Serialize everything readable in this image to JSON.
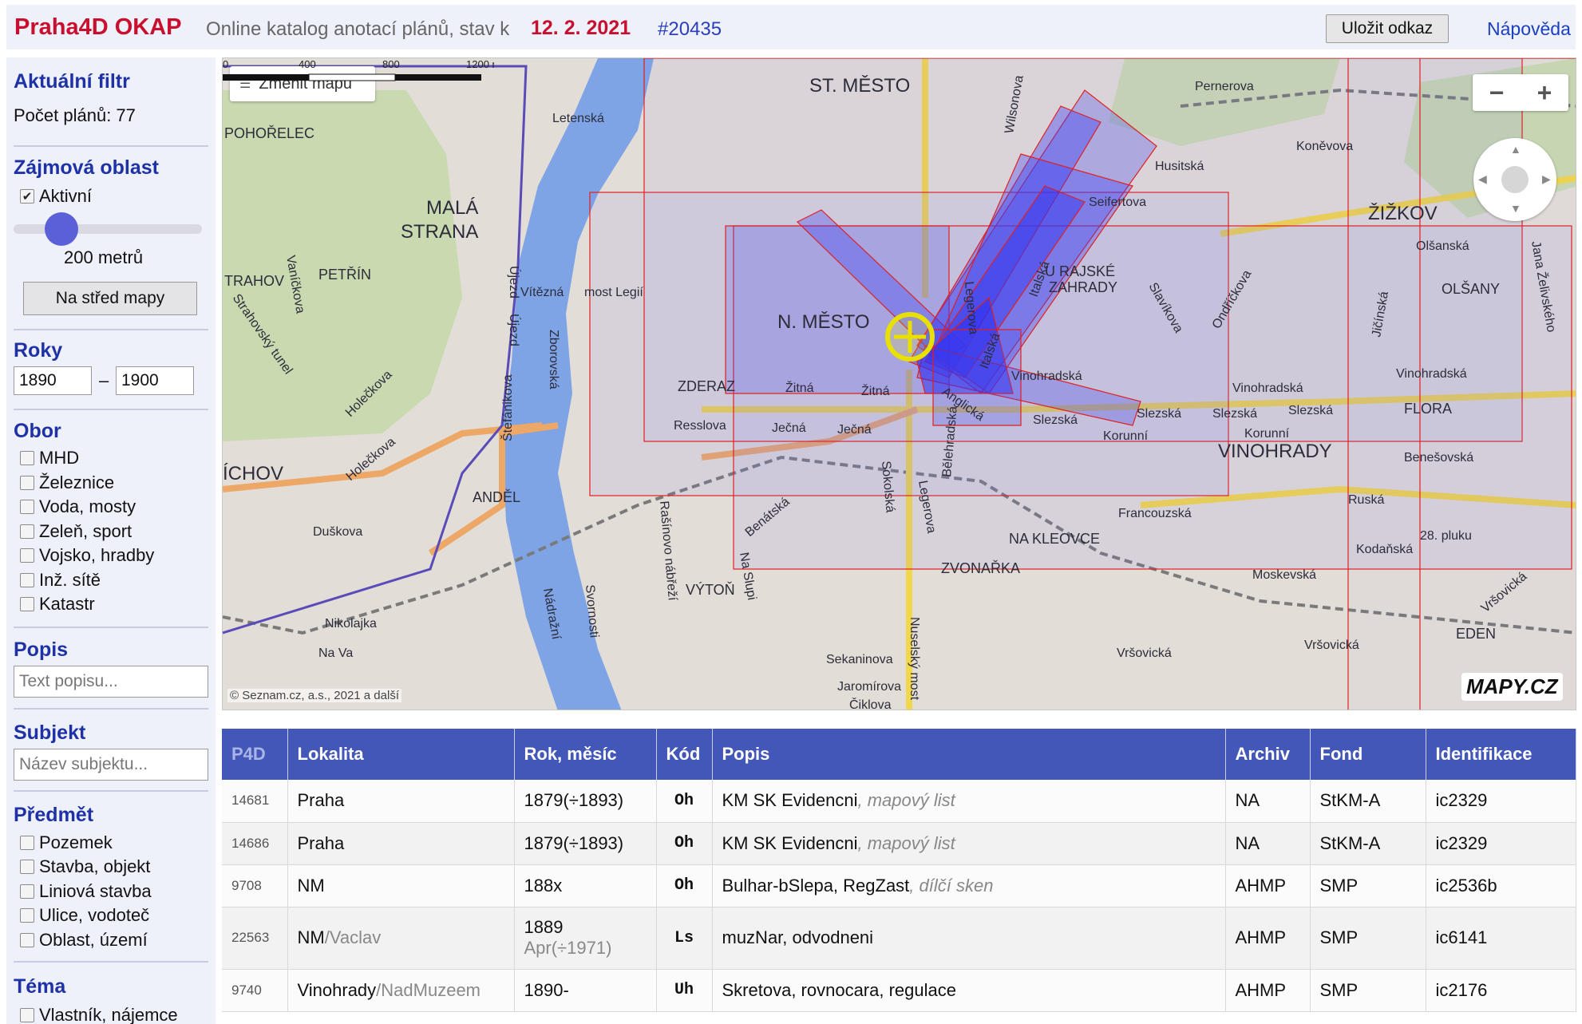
{
  "header": {
    "title": "Praha4D OKAP",
    "subtitle": "Online katalog anotací plánů, stav k",
    "date": "12. 2. 2021",
    "id": "#20435",
    "save_link": "Uložit odkaz",
    "help": "Nápověda"
  },
  "sidebar": {
    "filter": {
      "heading": "Aktuální filtr",
      "count_text": "Počet plánů: 77"
    },
    "area": {
      "heading": "Zájmová oblast",
      "active_label": "Aktivní",
      "active_checked": true,
      "radius": "200 metrů",
      "center_button": "Na střed mapy"
    },
    "years": {
      "heading": "Roky",
      "from": "1890",
      "dash": "–",
      "to": "1900"
    },
    "field": {
      "heading": "Obor",
      "items": [
        "MHD",
        "Železnice",
        "Voda, mosty",
        "Zeleň, sport",
        "Vojsko, hradby",
        "Inž. sítě",
        "Katastr"
      ]
    },
    "description": {
      "heading": "Popis",
      "placeholder": "Text popisu..."
    },
    "subject": {
      "heading": "Subjekt",
      "placeholder": "Název subjektu..."
    },
    "object": {
      "heading": "Předmět",
      "items": [
        "Pozemek",
        "Stavba, objekt",
        "Liniová stavba",
        "Ulice, vodoteč",
        "Oblast, území"
      ]
    },
    "theme": {
      "heading": "Téma",
      "items": [
        "Vlastník, nájemce"
      ]
    }
  },
  "map": {
    "change_map": "Změnit mapu",
    "zoom_out": "−",
    "zoom_in": "+",
    "copyright": "© Seznam.cz, a.s., 2021 a další",
    "logo": "MAPY.CZ",
    "scale_labels": [
      "0",
      "400",
      "800",
      "1200 m"
    ],
    "labels": {
      "st_mesto": "ST. MĚSTO",
      "mala_strana": "MALÁ",
      "mala_strana2": "STRANA",
      "n_mesto": "N. MĚSTO",
      "zizkov": "ŽIŽKOV",
      "vinohrady": "VINOHRADY",
      "petrin": "PETŘÍN",
      "pohorelec": "POHOŘELEC",
      "strahov": "TRAHOV",
      "olsany": "OLŠANY",
      "flora": "FLORA",
      "eden": "EDEN",
      "andel": "ANDĚL",
      "zderaz": "ZDERAZ",
      "vyton": "VÝTOŇ",
      "zvonarka": "ZVONAŘKA",
      "na_kleovce": "NA KLEOVCE",
      "urajske": "U RAJSKÉ",
      "zahrady": "ZAHRADY",
      "smichov": "ÍCHOV",
      "legii": "most Legií",
      "vitezna": "Vítězná",
      "zitna1": "Žitná",
      "zitna2": "Žitná",
      "jecna1": "Ječná",
      "jecna2": "Ječná",
      "resslova": "Resslova",
      "vinohradska1": "Vinohradská",
      "vinohradska2": "Vinohradská",
      "vinohradska3": "Vinohradská",
      "slezska1": "Slezská",
      "slezska2": "Slezská",
      "slezska3": "Slezská",
      "slezska4": "Slezská",
      "korunni1": "Korunní",
      "korunni2": "Korunní",
      "francouzska": "Francouzská",
      "ruska": "Ruská",
      "seifertova": "Seifertova",
      "husitska": "Husitská",
      "konevova": "Koněvova",
      "olsanska": "Olšanská",
      "jicinska": "Jičínská",
      "moskevska": "Moskevská",
      "vrsovicka1": "Vršovická",
      "vrsovicka2": "Vršovická",
      "sekaninova": "Sekaninova",
      "jaromirova": "Jaromírova",
      "ciklova": "Čiklova",
      "nikolajka": "Nikolajka",
      "duskova": "Duškova",
      "holeckova1": "Holečkova",
      "holeckova2": "Holečkova",
      "benesovska": "Benešovská",
      "kodanska": "Kodaňská",
      "pluku": "28. pluku",
      "perneroya": "Pernerova",
      "letenska": "Letenská",
      "ujezd1": "Újezd",
      "ujezd2": "Újezd",
      "zborovska": "Zborovská",
      "stefanikova": "Štefánikova",
      "rasinovo": "Rašínovo nábřeží",
      "nadrazni": "Nádražní",
      "svornosti": "Svornosti",
      "benatska": "Benátská",
      "na_slupi": "Na Slupi",
      "legerova1": "Legerova",
      "legerova2": "Legerova",
      "sokolska": "Sokolská",
      "belehradska": "Bělehradská",
      "nuselsky": "Nuselský most",
      "italska1": "Italská",
      "italska2": "Italská",
      "anglicka": "Anglická",
      "vinohradska_s": "Vinohradská",
      "wilsonova": "Wilsonova",
      "slavikova": "Slavíkova",
      "ondrickova": "Ondříčkova",
      "vanickova": "Vaníčkova",
      "strahovsky": "Strahovský tunel",
      "jana_zel": "Jana Želivského",
      "vrsovicka3": "Vršovická",
      "na_valech": "Na Va"
    }
  },
  "table": {
    "columns": [
      "P4D",
      "Lokalita",
      "Rok, měsíc",
      "Kód",
      "Popis",
      "Archiv",
      "Fond",
      "Identifikace"
    ],
    "rows": [
      {
        "p4d": "14681",
        "lokalita": "Praha",
        "lokalita_sub": "",
        "rok": "1879(÷1893)",
        "rok_sub": "",
        "kod": "Oh",
        "kod_color": "#777777",
        "popis": "KM SK Evidencni",
        "popis_sub": "mapový list",
        "archiv": "NA",
        "fond": "StKM-A",
        "ident": "ic2329"
      },
      {
        "p4d": "14686",
        "lokalita": "Praha",
        "lokalita_sub": "",
        "rok": "1879(÷1893)",
        "rok_sub": "",
        "kod": "Oh",
        "kod_color": "#777777",
        "popis": "KM SK Evidencni",
        "popis_sub": "mapový list",
        "archiv": "NA",
        "fond": "StKM-A",
        "ident": "ic2329"
      },
      {
        "p4d": "9708",
        "lokalita": "NM",
        "lokalita_sub": "",
        "rok": "188x",
        "rok_sub": "",
        "kod": "Oh",
        "kod_color": "#777777",
        "popis": "Bulhar-bSlepa, RegZast",
        "popis_sub": "dílčí sken",
        "archiv": "AHMP",
        "fond": "SMP",
        "ident": "ic2536b"
      },
      {
        "p4d": "22563",
        "lokalita": "NM",
        "lokalita_sub": "/Vaclav",
        "rok": "1889",
        "rok_sub": "Apr(÷1971)",
        "kod": "Ls",
        "kod_color": "#cc1010",
        "popis": "muzNar, odvodneni",
        "popis_sub": "",
        "archiv": "AHMP",
        "fond": "SMP",
        "ident": "ic6141"
      },
      {
        "p4d": "9740",
        "lokalita": "Vinohrady",
        "lokalita_sub": "/NadMuzeem",
        "rok": "1890-",
        "rok_sub": "",
        "kod": "Uh",
        "kod_color": "#cc1010",
        "popis": "Skretova, rovnocara, regulace",
        "popis_sub": "",
        "archiv": "AHMP",
        "fond": "SMP",
        "ident": "ic2176"
      }
    ]
  }
}
